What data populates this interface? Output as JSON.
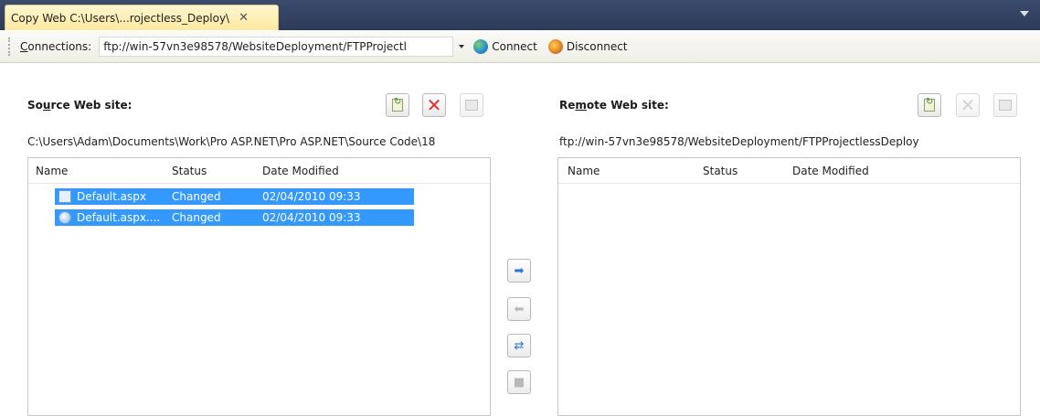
{
  "window": {
    "tab_title": "Copy Web C:\\Users\\...rojectless_Deploy\\",
    "tab_close": "✕"
  },
  "connection_bar": {
    "label_prefix": "C",
    "label_rest": "onnections:",
    "url_value": "ftp://win-57vn3e98578/WebsiteDeployment/FTPProjectl",
    "connect_label": "Connect",
    "disconnect_label": "Disconnect"
  },
  "source": {
    "heading_prefix": "So",
    "heading_underline": "u",
    "heading_rest": "rce Web site:",
    "path": "C:\\Users\\Adam\\Documents\\Work\\Pro ASP.NET\\Pro ASP.NET\\Source Code\\18",
    "columns": [
      "Name",
      "Status",
      "Date Modified"
    ],
    "rows": [
      {
        "name": "Default.aspx",
        "status": "Changed",
        "date": "02/04/2010 09:33",
        "icon": "aspx-file-icon"
      },
      {
        "name": "Default.aspx....",
        "status": "Changed",
        "date": "02/04/2010 09:33",
        "icon": "cs-code-file-icon"
      }
    ]
  },
  "remote": {
    "heading_prefix": "Re",
    "heading_underline": "m",
    "heading_rest": "ote Web site:",
    "path": "ftp://win-57vn3e98578/WebsiteDeployment/FTPProjectlessDeploy",
    "columns": [
      "Name",
      "Status",
      "Date Modified"
    ],
    "rows": []
  },
  "colors": {
    "selection": "#3399ff",
    "tab_active": "#ffe9a0",
    "titlebar": "#2e3c5a"
  }
}
